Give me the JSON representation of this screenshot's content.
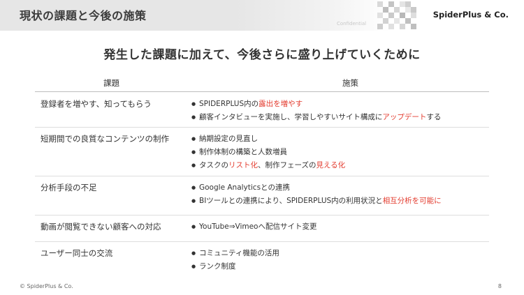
{
  "header": {
    "title": "現状の課題と今後の施策",
    "confidential": "Confidential",
    "brand": "SpiderPlus & Co."
  },
  "headline": "発生した課題に加えて、今後さらに盛り上げていくために",
  "table": {
    "columns": [
      "課題",
      "施策"
    ],
    "rows": [
      {
        "issue": "登録者を増やす、知ってもらう",
        "measures": [
          [
            {
              "t": "SPIDERPLUS内の"
            },
            {
              "t": "露出を増やす",
              "hl": true
            }
          ],
          [
            {
              "t": "顧客インタビューを実施し、学習しやすいサイト構成に"
            },
            {
              "t": "アップデート",
              "hl": true
            },
            {
              "t": "する"
            }
          ]
        ]
      },
      {
        "issue": "短期間での良質なコンテンツの制作",
        "measures": [
          [
            {
              "t": "納期設定の見直し"
            }
          ],
          [
            {
              "t": "制作体制の構築と人数増員"
            }
          ],
          [
            {
              "t": "タスクの"
            },
            {
              "t": "リスト化",
              "hl": true
            },
            {
              "t": "、制作フェーズの"
            },
            {
              "t": "見える化",
              "hl": true
            }
          ]
        ]
      },
      {
        "issue": "分析手段の不足",
        "measures": [
          [
            {
              "t": "Google Analyticsとの連携"
            }
          ],
          [
            {
              "t": "BIツールとの連携により、SPIDERPLUS内の利用状況と"
            },
            {
              "t": "相互分析を可能に",
              "hl": true
            }
          ]
        ]
      },
      {
        "issue": "動画が閲覧できない顧客への対応",
        "measures": [
          [
            {
              "t": "YouTube⇒Vimeoへ配信サイト変更"
            }
          ]
        ]
      },
      {
        "issue": "ユーザー同士の交流",
        "measures": [
          [
            {
              "t": "コミュニティ機能の活用"
            }
          ],
          [
            {
              "t": "ランク制度"
            }
          ]
        ]
      }
    ]
  },
  "footer": {
    "copyright": "© SpiderPlus & Co.",
    "page_number": "8"
  },
  "colors": {
    "highlight": "#e33b2e",
    "header_band": "#e6e6e6",
    "text": "#333333"
  }
}
